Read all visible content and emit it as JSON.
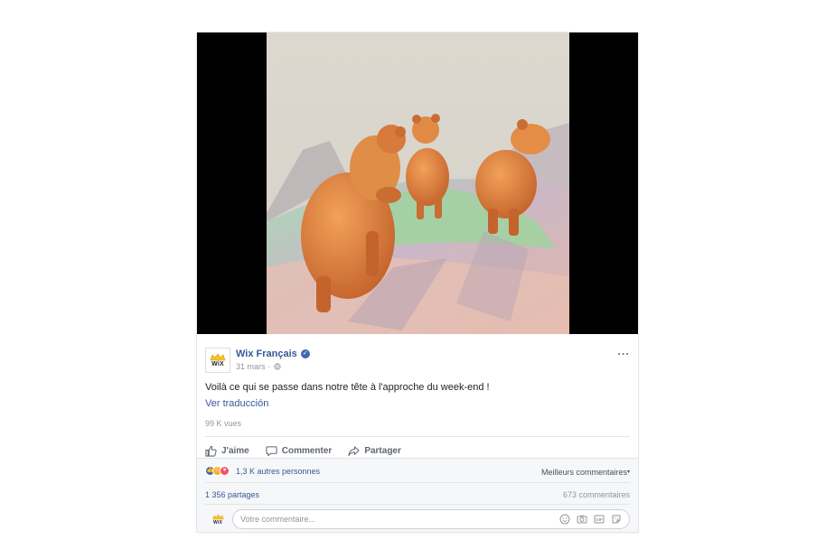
{
  "page": {
    "name": "Wix Français",
    "avatar_text": "WiX",
    "verified_mark": "✓",
    "date": "31 mars",
    "meta_separator": "·",
    "more_label": "···"
  },
  "post": {
    "text": "Voilà ce qui se passe dans notre tête à l'approche du week-end !",
    "translate_link": "Ver traducción",
    "views": "99 K vues"
  },
  "actions": {
    "like": "J'aime",
    "comment": "Commenter",
    "share": "Partager"
  },
  "reactions": {
    "count_text": "1,3 K autres personnes",
    "sort_label": "Meilleurs commentaires",
    "shares": "1 356 partages",
    "comments": "673 commentaires",
    "types": [
      "like",
      "haha",
      "love"
    ]
  },
  "comment_box": {
    "placeholder": "Votre commentaire...",
    "icons": [
      "emoji-icon",
      "camera-icon",
      "gif-icon",
      "sticker-icon"
    ]
  },
  "colors": {
    "link_blue": "#365899",
    "fb_blue": "#4267b2",
    "muted": "#90949c",
    "video_bg": "#000000"
  }
}
